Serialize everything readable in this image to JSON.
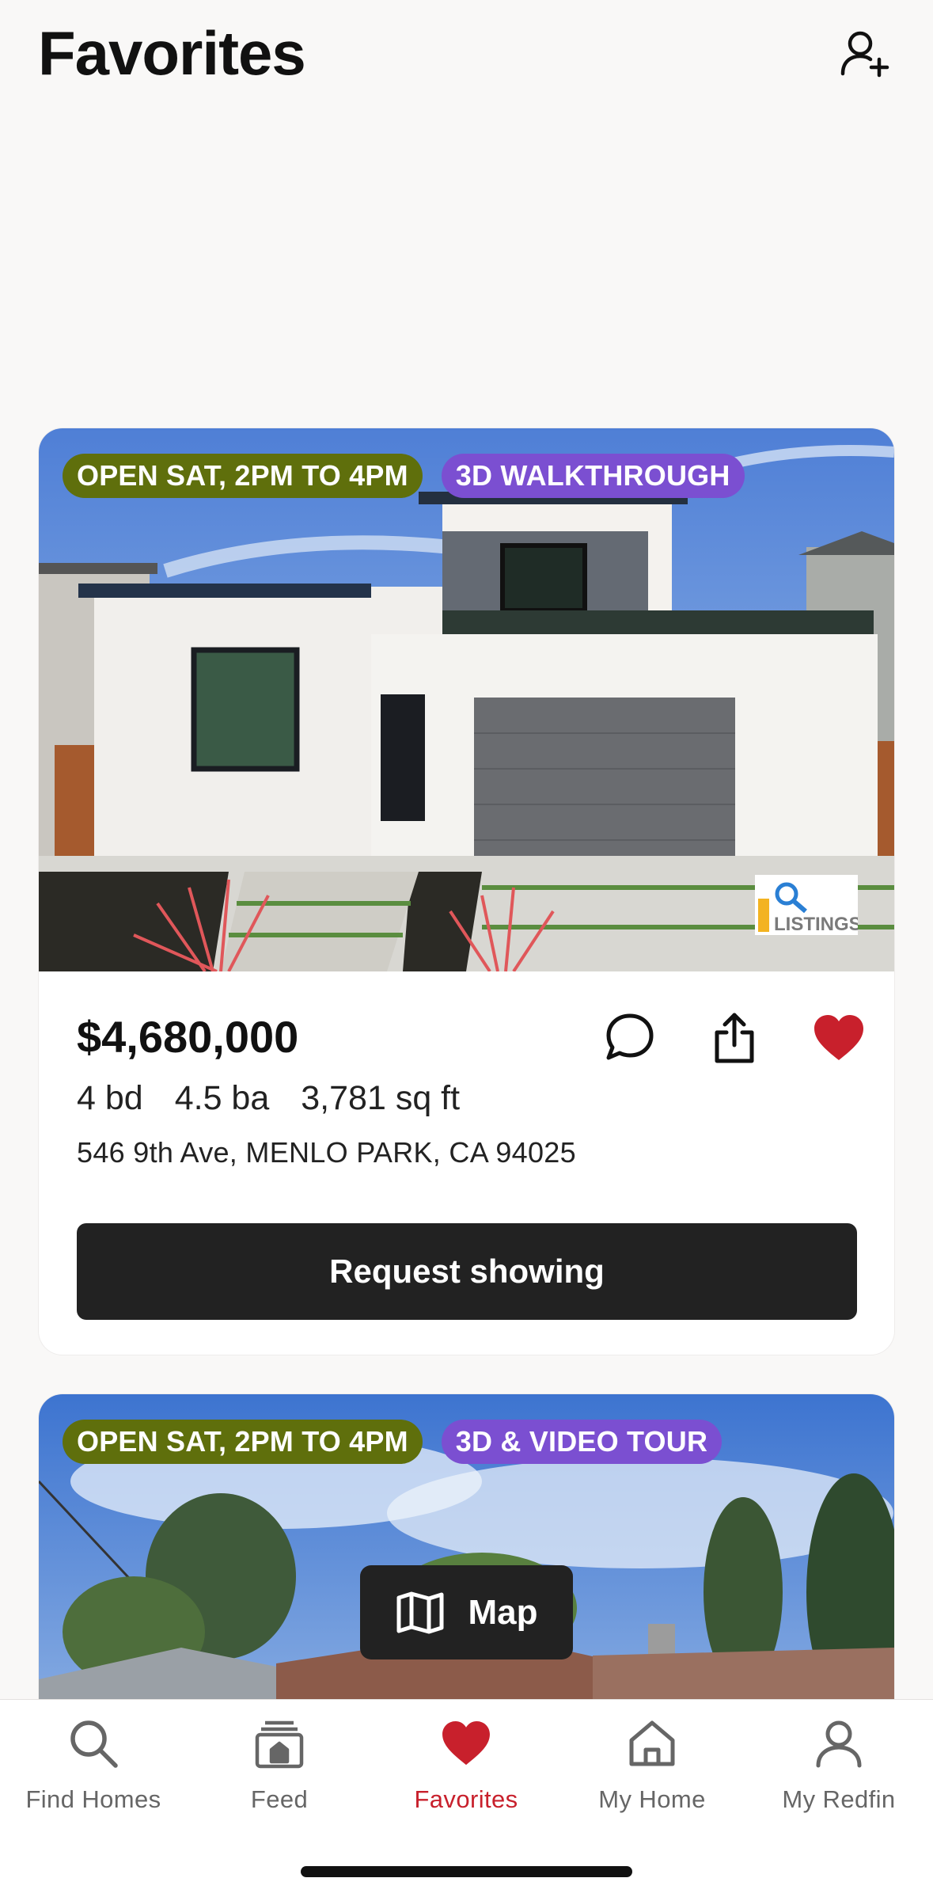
{
  "header": {
    "title": "Favorites",
    "add_user_icon": "person-plus-icon"
  },
  "listings": [
    {
      "badges": [
        "OPEN SAT, 2PM TO 4PM",
        "3D WALKTHROUGH"
      ],
      "price": "$4,680,000",
      "beds": "4 bd",
      "baths": "4.5 ba",
      "sqft": "3,781 sq ft",
      "address": "546 9th Ave, MENLO PARK, CA 94025",
      "favorited": true,
      "cta": "Request showing",
      "photo_credit": "MLSLISTINGS"
    },
    {
      "badges": [
        "OPEN SAT, 2PM TO 4PM",
        "3D & VIDEO TOUR"
      ]
    }
  ],
  "map_button": {
    "label": "Map",
    "icon": "map-icon"
  },
  "tabbar": {
    "active": "Favorites",
    "items": [
      {
        "label": "Find Homes",
        "icon": "search-icon"
      },
      {
        "label": "Feed",
        "icon": "feed-icon"
      },
      {
        "label": "Favorites",
        "icon": "heart-icon"
      },
      {
        "label": "My Home",
        "icon": "house-icon"
      },
      {
        "label": "My Redfin",
        "icon": "user-icon"
      }
    ]
  },
  "colors": {
    "accent_red": "#c8202c",
    "badge_open": "#5f6f0c",
    "badge_tour": "#7b4fd1",
    "button_dark": "#222222"
  }
}
